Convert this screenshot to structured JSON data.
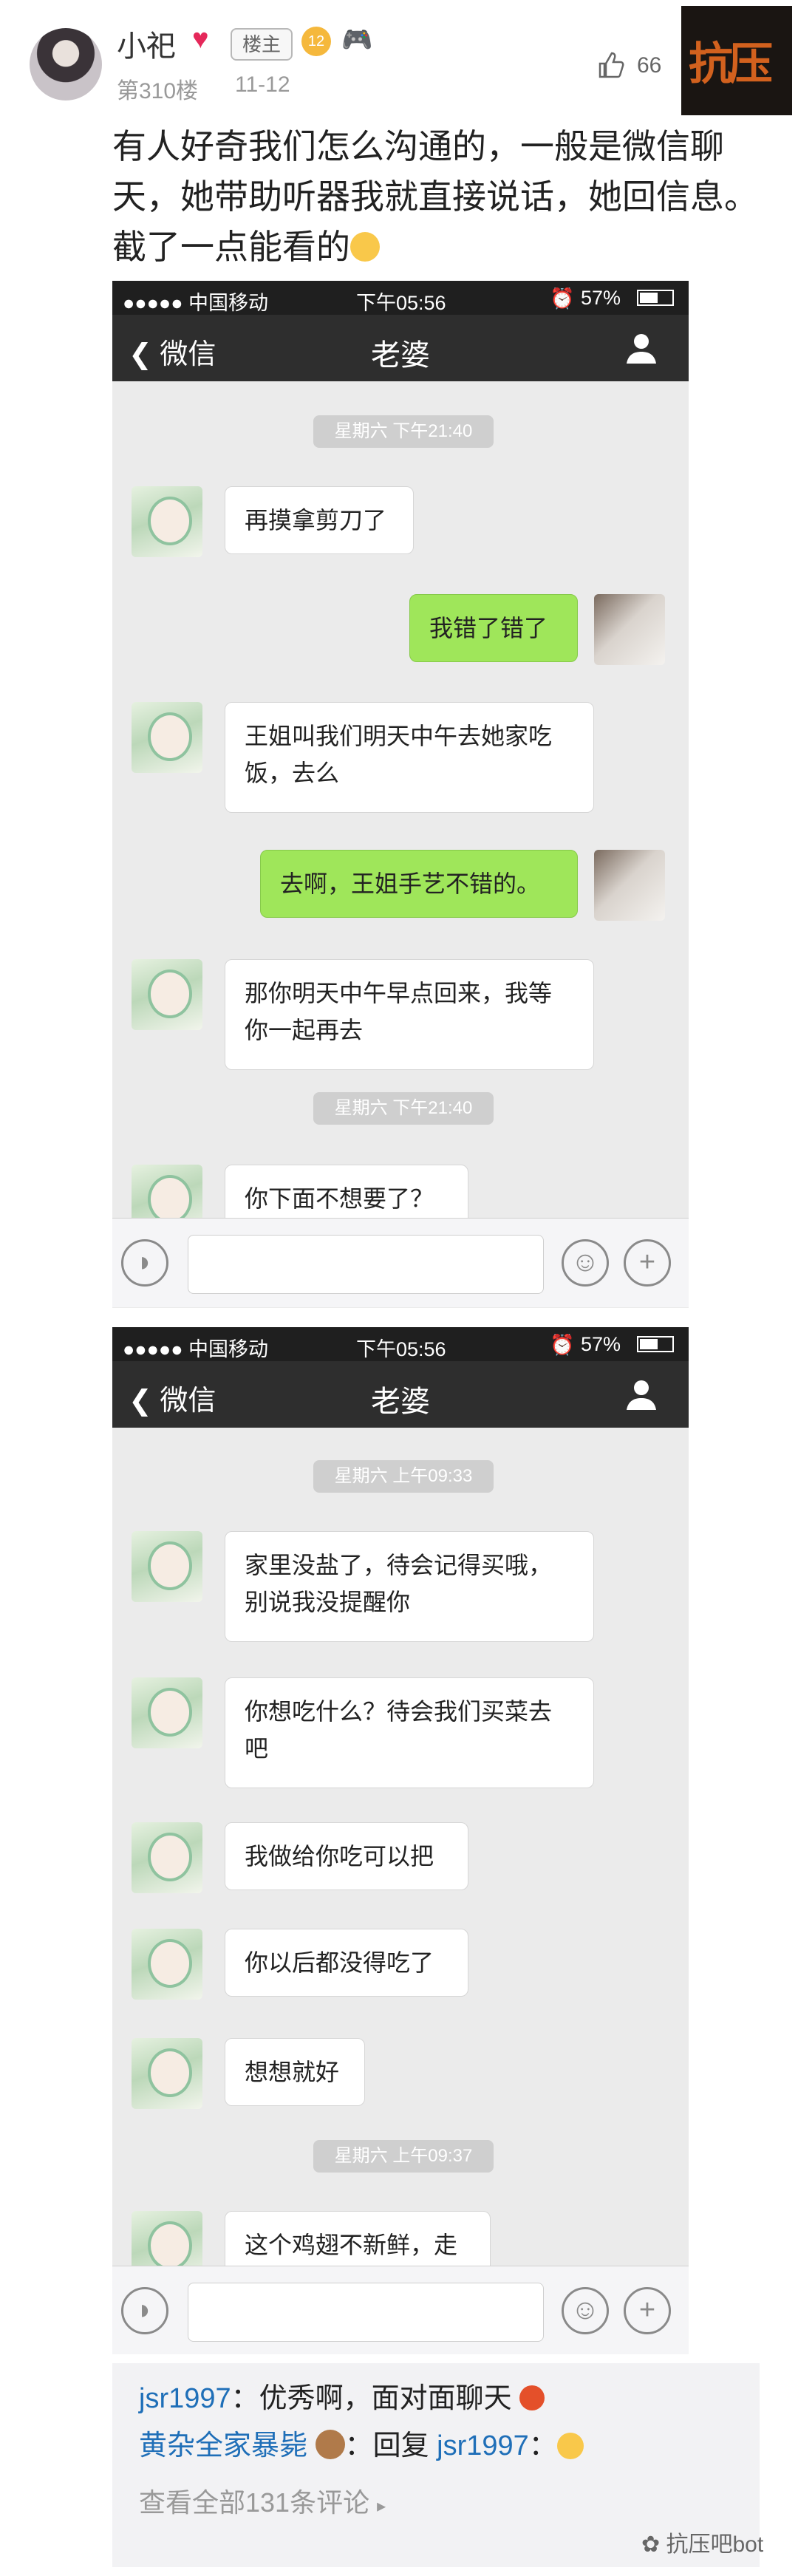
{
  "post": {
    "username": "小祀",
    "owner_badge": "楼主",
    "level": "12",
    "floor": "第310楼",
    "date": "11-12",
    "likes": "66",
    "text": "有人好奇我们怎么沟通的，一般是微信聊天，她带助听器我就直接说话，她回信息。截了一点能看的",
    "logo_text": "抗压"
  },
  "shot1": {
    "status": {
      "carrier": "●●●●● 中国移动",
      "time": "下午05:56",
      "battery": "57%"
    },
    "nav": {
      "back": "微信",
      "title": "老婆"
    },
    "time1": "星期六 下午21:40",
    "msgs": [
      {
        "from": "her",
        "text": "再摸拿剪刀了"
      },
      {
        "from": "me",
        "text": "我错了错了"
      },
      {
        "from": "her",
        "text": "王姐叫我们明天中午去她家吃饭，去么"
      },
      {
        "from": "me",
        "text": "去啊，王姐手艺不错的。"
      },
      {
        "from": "her",
        "text": "那你明天中午早点回来，我等你一起再去"
      }
    ],
    "time2": "星期六 下午21:40",
    "last": "你下面不想要了？"
  },
  "shot2": {
    "status": {
      "carrier": "●●●●● 中国移动",
      "time": "下午05:56",
      "battery": "57%"
    },
    "nav": {
      "back": "微信",
      "title": "老婆"
    },
    "time1": "星期六 上午09:33",
    "msgs": [
      {
        "from": "her",
        "text": "家里没盐了，待会记得买哦，别说我没提醒你"
      },
      {
        "from": "her",
        "text": "你想吃什么？待会我们买菜去吧"
      },
      {
        "from": "her",
        "text": "我做给你吃可以把"
      },
      {
        "from": "her",
        "text": "你以后都没得吃了"
      },
      {
        "from": "her",
        "text": "想想就好"
      }
    ],
    "time2": "星期六 上午09:37",
    "last": "这个鸡翅不新鲜，走"
  },
  "comments": {
    "c1_name": "jsr1997",
    "c1_text": "：优秀啊，面对面聊天",
    "c2_name": "黄杂全家暴毙",
    "c2_text": "：回复",
    "c2_reply": "jsr1997",
    "c2_tail": "：",
    "more": "查看全部131条评论"
  },
  "watermark": "抗压吧bot"
}
